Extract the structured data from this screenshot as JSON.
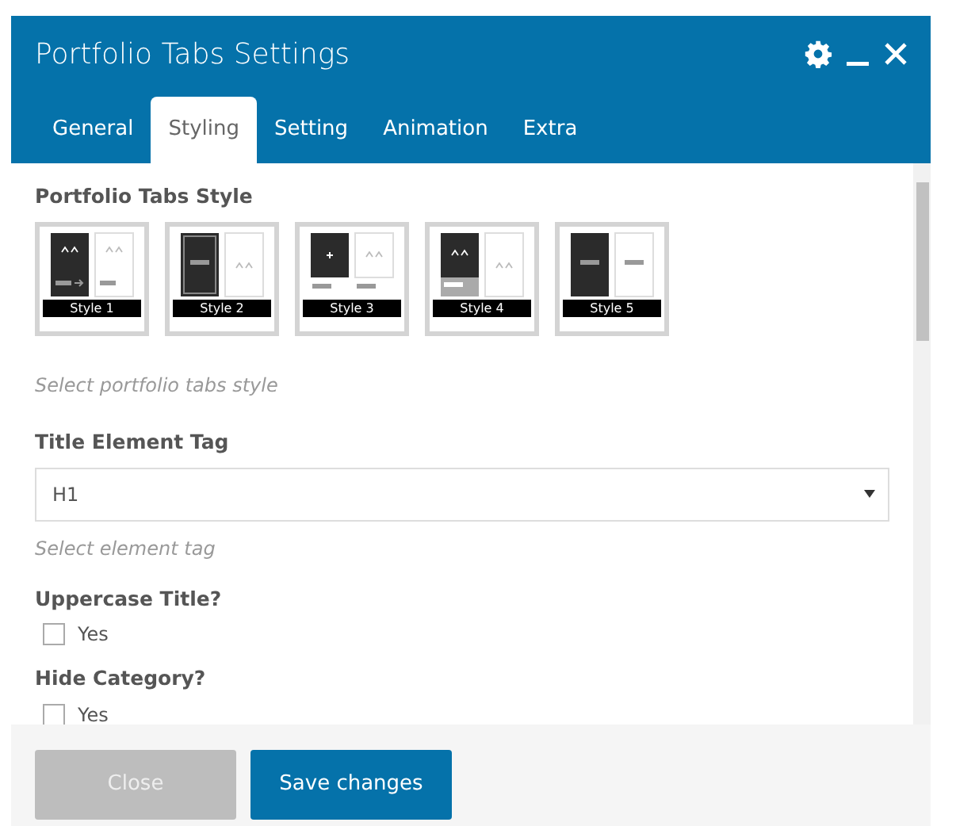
{
  "window": {
    "title": "Portfolio Tabs Settings"
  },
  "tabs": [
    {
      "label": "General",
      "selected": false
    },
    {
      "label": "Styling",
      "selected": true
    },
    {
      "label": "Setting",
      "selected": false
    },
    {
      "label": "Animation",
      "selected": false
    },
    {
      "label": "Extra",
      "selected": false
    }
  ],
  "style_field": {
    "label": "Portfolio Tabs Style",
    "options": [
      "Style 1",
      "Style 2",
      "Style 3",
      "Style 4",
      "Style 5"
    ],
    "hint": "Select portfolio tabs style"
  },
  "tag_field": {
    "label": "Title Element Tag",
    "value": "H1",
    "hint": "Select element tag"
  },
  "checkboxes": [
    {
      "label": "Uppercase Title?",
      "option": "Yes",
      "checked": false
    },
    {
      "label": "Hide Category?",
      "option": "Yes",
      "checked": false
    }
  ],
  "buttons": [
    {
      "label": "Close",
      "disabled": true
    },
    {
      "label": "Save changes",
      "disabled": false
    }
  ]
}
